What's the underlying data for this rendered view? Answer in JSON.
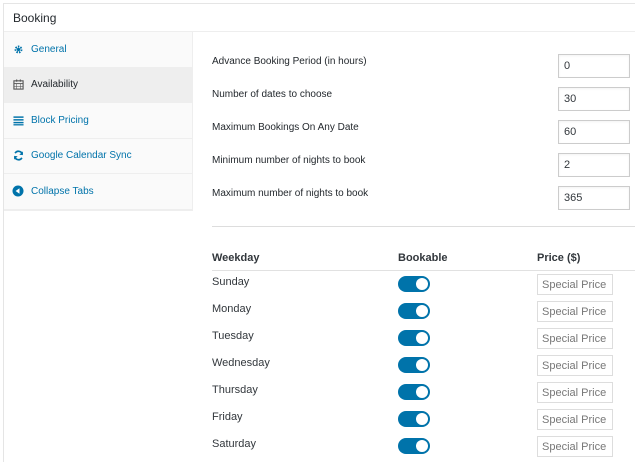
{
  "panel": {
    "title": "Booking"
  },
  "tabs": [
    {
      "label": "General",
      "icon": "gear-icon",
      "active": false
    },
    {
      "label": "Availability",
      "icon": "calendar-icon",
      "active": true
    },
    {
      "label": "Block Pricing",
      "icon": "list-icon",
      "active": false
    },
    {
      "label": "Google Calendar Sync",
      "icon": "sync-icon",
      "active": false
    },
    {
      "label": "Collapse Tabs",
      "icon": "collapse-arrow-icon",
      "active": false
    }
  ],
  "fields": [
    {
      "label": "Advance Booking Period (in hours)",
      "value": "0"
    },
    {
      "label": "Number of dates to choose",
      "value": "30"
    },
    {
      "label": "Maximum Bookings On Any Date",
      "value": "60"
    },
    {
      "label": "Minimum number of nights to book",
      "value": "2"
    },
    {
      "label": "Maximum number of nights to book",
      "value": "365"
    }
  ],
  "weekdays": {
    "headers": {
      "weekday": "Weekday",
      "bookable": "Bookable",
      "price": "Price ($)"
    },
    "price_placeholder": "Special Price",
    "rows": [
      {
        "day": "Sunday",
        "bookable": true
      },
      {
        "day": "Monday",
        "bookable": true
      },
      {
        "day": "Tuesday",
        "bookable": true
      },
      {
        "day": "Wednesday",
        "bookable": true
      },
      {
        "day": "Thursday",
        "bookable": true
      },
      {
        "day": "Friday",
        "bookable": true
      },
      {
        "day": "Saturday",
        "bookable": true
      }
    ]
  },
  "colors": {
    "accent": "#0073aa",
    "active_tab_bg": "#eeeeee",
    "sidebar_bg": "#fafafa"
  }
}
